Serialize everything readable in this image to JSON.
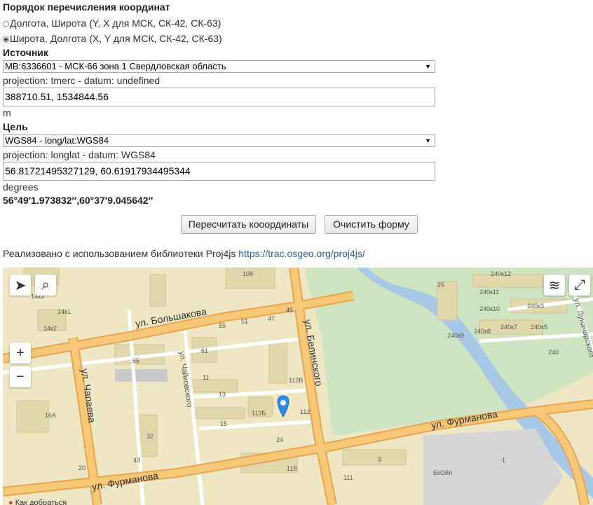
{
  "order": {
    "heading": "Порядок перечисления координат",
    "options": [
      {
        "label": "Долгота, Широта (Y, X для МСК, СК-42, СК-63)",
        "selected": false
      },
      {
        "label": "Широта, Долгота (X, Y для МСК, СК-42, СК-63)",
        "selected": true
      }
    ]
  },
  "source": {
    "heading": "Источник",
    "select_value": "МВ:6336601 - МСК-66 зона 1 Свердловская область",
    "projection": "projection: tmerc - datum: undefined",
    "coords": "388710.51, 1534844.56",
    "units": "m"
  },
  "target": {
    "heading": "Цель",
    "select_value": "WGS84 - long/lat:WGS84",
    "projection": "projection: longlat - datum: WGS84",
    "coords": "56.81721495327129, 60.61917934495344",
    "units": "degrees",
    "dms": "56°49′1.973832″,60°37′9.045642″"
  },
  "buttons": {
    "recalc": "Пересчитать кооординаты",
    "clear": "Очистить форму"
  },
  "credit": {
    "text": "Реализовано с использованием библиотеки Proj4js",
    "link": "https://trac.osgeo.org/proj4js/"
  },
  "map": {
    "streets": [
      "ул. Большакова",
      "ул. Белинского",
      "ул. Чапаева",
      "ул. Фурманова",
      "ул. Фурманова",
      "ул. Чайковского",
      "ул. Луначарского"
    ],
    "labels": [
      "108",
      "14к3",
      "14к1",
      "14к2",
      "55",
      "51",
      "47",
      "45",
      "61",
      "65",
      "11",
      "13",
      "15",
      "16А",
      "32",
      "43",
      "20",
      "24",
      "112Б",
      "112В",
      "112",
      "118",
      "3",
      "1",
      "25",
      "240к12",
      "240к11",
      "240к10",
      "240к3",
      "240к9",
      "240к8",
      "240к7",
      "240к5",
      "240",
      "ЕкОйл",
      "111"
    ],
    "hint": "Как добраться"
  }
}
